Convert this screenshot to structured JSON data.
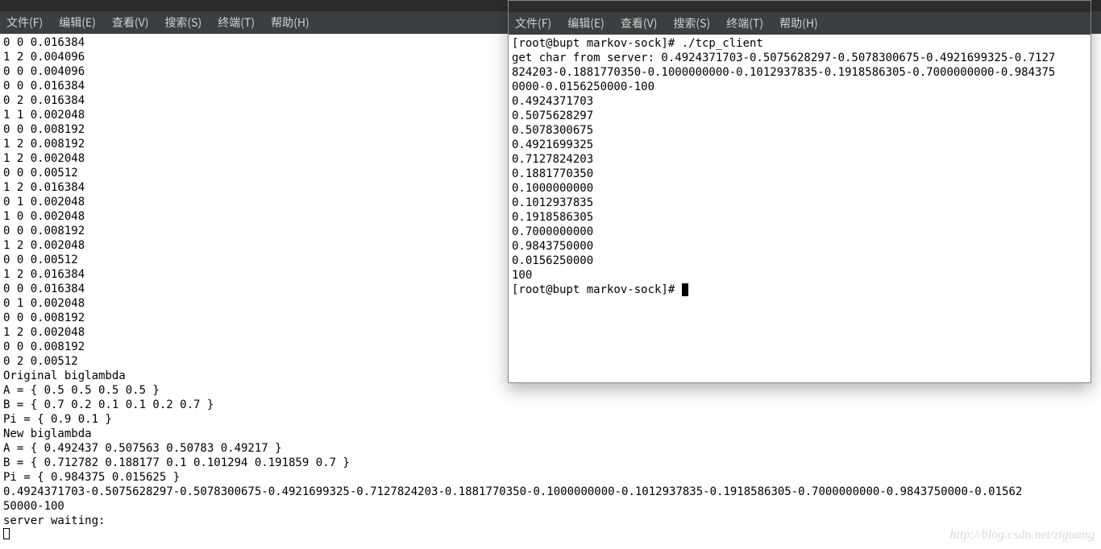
{
  "menubar": {
    "file": "文件(F)",
    "edit": "编辑(E)",
    "view": "查看(V)",
    "search": "搜索(S)",
    "terminal": "终端(T)",
    "help": "帮助(H)"
  },
  "left_terminal": {
    "lines": [
      "0 0 0.016384",
      "1 2 0.004096",
      "0 0 0.004096",
      "0 0 0.016384",
      "0 2 0.016384",
      "1 1 0.002048",
      "0 0 0.008192",
      "1 2 0.008192",
      "1 2 0.002048",
      "0 0 0.00512",
      "1 2 0.016384",
      "0 1 0.002048",
      "1 0 0.002048",
      "0 0 0.008192",
      "1 2 0.002048",
      "0 0 0.00512",
      "1 2 0.016384",
      "0 0 0.016384",
      "0 1 0.002048",
      "0 0 0.008192",
      "1 2 0.002048",
      "0 0 0.008192",
      "0 2 0.00512",
      "Original biglambda",
      "A = { 0.5 0.5 0.5 0.5 }",
      "B = { 0.7 0.2 0.1 0.1 0.2 0.7 }",
      "Pi = { 0.9 0.1 }",
      "New biglambda",
      "A = { 0.492437 0.507563 0.50783 0.49217 }",
      "B = { 0.712782 0.188177 0.1 0.101294 0.191859 0.7 }",
      "Pi = { 0.984375 0.015625 }",
      "0.4924371703-0.5075628297-0.5078300675-0.4921699325-0.7127824203-0.1881770350-0.1000000000-0.1012937835-0.1918586305-0.7000000000-0.9843750000-0.01562",
      "50000-100",
      "server waiting:"
    ],
    "cursor_line": "▯"
  },
  "right_terminal": {
    "prompt1": "[root@bupt markov-sock]# ./tcp_client",
    "line1": "get char from server: 0.4924371703-0.5075628297-0.5078300675-0.4921699325-0.7127",
    "line2": "824203-0.1881770350-0.1000000000-0.1012937835-0.1918586305-0.7000000000-0.984375",
    "line3": "0000-0.0156250000-100",
    "values": [
      "0.4924371703",
      "0.5075628297",
      "0.5078300675",
      "0.4921699325",
      "0.7127824203",
      "0.1881770350",
      "0.1000000000",
      "0.1012937835",
      "0.1918586305",
      "0.7000000000",
      "0.9843750000",
      "0.0156250000",
      "100"
    ],
    "prompt2": "[root@bupt markov-sock]# "
  },
  "watermark": "http://blog.csdn.net/ztguang"
}
